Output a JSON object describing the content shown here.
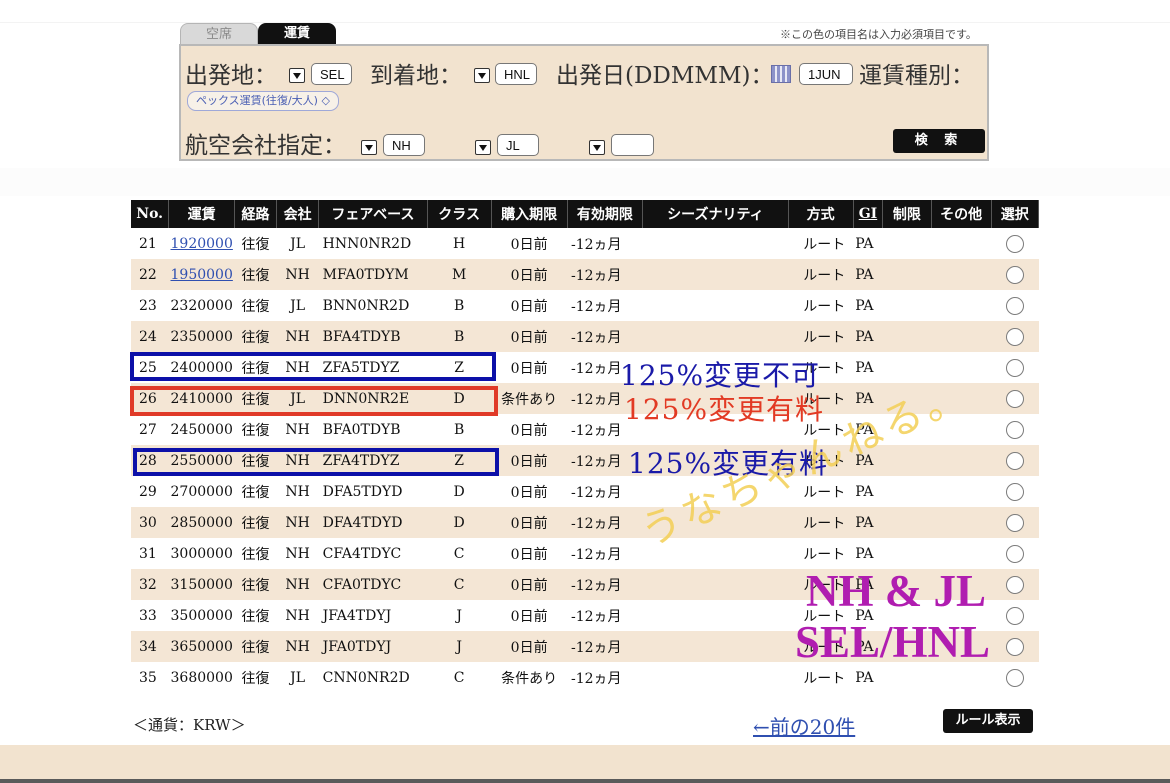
{
  "tabs": {
    "vacancy": "空席",
    "fare": "運賃"
  },
  "required_note": "※この色の項目名は入力必須項目です。",
  "search": {
    "origin_label": "出発地：",
    "origin_value": "SEL",
    "destination_label": "到着地：",
    "destination_value": "HNL",
    "date_label": "出発日(DDMMM)：",
    "date_value": "1JUN",
    "fare_type_label": "運賃種別：",
    "fare_type_value": "ペックス運賃(往復/大人)",
    "airline_label": "航空会社指定：",
    "airline1": "NH",
    "airline2": "JL",
    "airline3": "",
    "search_button": "検 索"
  },
  "table": {
    "headers": [
      "No.",
      "運賃",
      "経路",
      "会社",
      "フェアベース",
      "クラス",
      "購入期限",
      "有効期限",
      "シーズナリティ",
      "方式",
      "GI",
      "制限",
      "その他",
      "選択"
    ],
    "rows": [
      {
        "no": "21",
        "fare": "1920000",
        "route": "往復",
        "airline": "JL",
        "basis": "HNN0NR2D",
        "cls": "H",
        "purchase": "0日前",
        "validity": "-12ヵ月",
        "method": "ルート",
        "gi": "PA"
      },
      {
        "no": "22",
        "fare": "1950000",
        "route": "往復",
        "airline": "NH",
        "basis": "MFA0TDYM",
        "cls": "M",
        "purchase": "0日前",
        "validity": "-12ヵ月",
        "method": "ルート",
        "gi": "PA"
      },
      {
        "no": "23",
        "fare": "2320000",
        "route": "往復",
        "airline": "JL",
        "basis": "BNN0NR2D",
        "cls": "B",
        "purchase": "0日前",
        "validity": "-12ヵ月",
        "method": "ルート",
        "gi": "PA"
      },
      {
        "no": "24",
        "fare": "2350000",
        "route": "往復",
        "airline": "NH",
        "basis": "BFA4TDYB",
        "cls": "B",
        "purchase": "0日前",
        "validity": "-12ヵ月",
        "method": "ルート",
        "gi": "PA"
      },
      {
        "no": "25",
        "fare": "2400000",
        "route": "往復",
        "airline": "NH",
        "basis": "ZFA5TDYZ",
        "cls": "Z",
        "purchase": "0日前",
        "validity": "-12ヵ月",
        "method": "ルート",
        "gi": "PA"
      },
      {
        "no": "26",
        "fare": "2410000",
        "route": "往復",
        "airline": "JL",
        "basis": "DNN0NR2E",
        "cls": "D",
        "purchase": "条件あり",
        "validity": "-12ヵ月",
        "method": "ルート",
        "gi": "PA"
      },
      {
        "no": "27",
        "fare": "2450000",
        "route": "往復",
        "airline": "NH",
        "basis": "BFA0TDYB",
        "cls": "B",
        "purchase": "0日前",
        "validity": "-12ヵ月",
        "method": "ルート",
        "gi": "PA"
      },
      {
        "no": "28",
        "fare": "2550000",
        "route": "往復",
        "airline": "NH",
        "basis": "ZFA4TDYZ",
        "cls": "Z",
        "purchase": "0日前",
        "validity": "-12ヵ月",
        "method": "ルート",
        "gi": "PA"
      },
      {
        "no": "29",
        "fare": "2700000",
        "route": "往復",
        "airline": "NH",
        "basis": "DFA5TDYD",
        "cls": "D",
        "purchase": "0日前",
        "validity": "-12ヵ月",
        "method": "ルート",
        "gi": "PA"
      },
      {
        "no": "30",
        "fare": "2850000",
        "route": "往復",
        "airline": "NH",
        "basis": "DFA4TDYD",
        "cls": "D",
        "purchase": "0日前",
        "validity": "-12ヵ月",
        "method": "ルート",
        "gi": "PA"
      },
      {
        "no": "31",
        "fare": "3000000",
        "route": "往復",
        "airline": "NH",
        "basis": "CFA4TDYC",
        "cls": "C",
        "purchase": "0日前",
        "validity": "-12ヵ月",
        "method": "ルート",
        "gi": "PA"
      },
      {
        "no": "32",
        "fare": "3150000",
        "route": "往復",
        "airline": "NH",
        "basis": "CFA0TDYC",
        "cls": "C",
        "purchase": "0日前",
        "validity": "-12ヵ月",
        "method": "ルート",
        "gi": "PA"
      },
      {
        "no": "33",
        "fare": "3500000",
        "route": "往復",
        "airline": "NH",
        "basis": "JFA4TDYJ",
        "cls": "J",
        "purchase": "0日前",
        "validity": "-12ヵ月",
        "method": "ルート",
        "gi": "PA"
      },
      {
        "no": "34",
        "fare": "3650000",
        "route": "往復",
        "airline": "NH",
        "basis": "JFA0TDYJ",
        "cls": "J",
        "purchase": "0日前",
        "validity": "-12ヵ月",
        "method": "ルート",
        "gi": "PA"
      },
      {
        "no": "35",
        "fare": "3680000",
        "route": "往復",
        "airline": "JL",
        "basis": "CNN0NR2D",
        "cls": "C",
        "purchase": "条件あり",
        "validity": "-12ヵ月",
        "method": "ルート",
        "gi": "PA"
      }
    ]
  },
  "annotations": {
    "no_change": "125%変更不可",
    "change_fee_1": "125%変更有料",
    "change_fee_2": "125%変更有料",
    "watermark": "うなちゃんねる。",
    "tag_line1": "NH & JL",
    "tag_line2": "SEL/HNL"
  },
  "currency_note": "＜通貨：KRW＞",
  "prev_link": "←前の20件",
  "rule_button": "ルール表示",
  "colors": {
    "panel_bg": "#f2e3cf",
    "row_alt": "#f4e6d5",
    "highlight_blue": "#0c10a8",
    "highlight_red": "#e03a28",
    "annotation_magenta": "#b01db0",
    "watermark_yellow": "#f3cf55",
    "link_blue": "#2f4fb0"
  }
}
